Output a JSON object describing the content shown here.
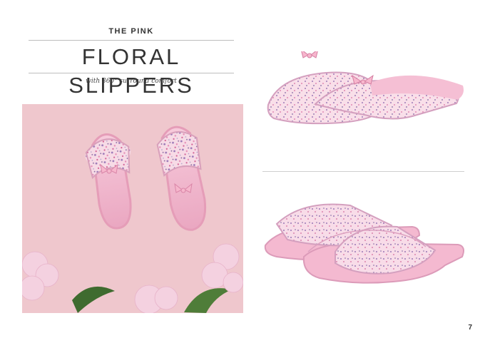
{
  "header": {
    "eyebrow": "THE PINK",
    "title": "FLORAL SLIPPERS",
    "subtitle": "with 360° surround comfort"
  },
  "footer": {
    "page_number": "7"
  },
  "colors": {
    "background": "#ffffff",
    "photo_bg": "#efc7cd",
    "slipper_pink": "#f1bfd1",
    "floral_purple": "#8b6aa8",
    "leaf_green": "#3f6b2f",
    "hydrangea": "#f4d1e0"
  }
}
